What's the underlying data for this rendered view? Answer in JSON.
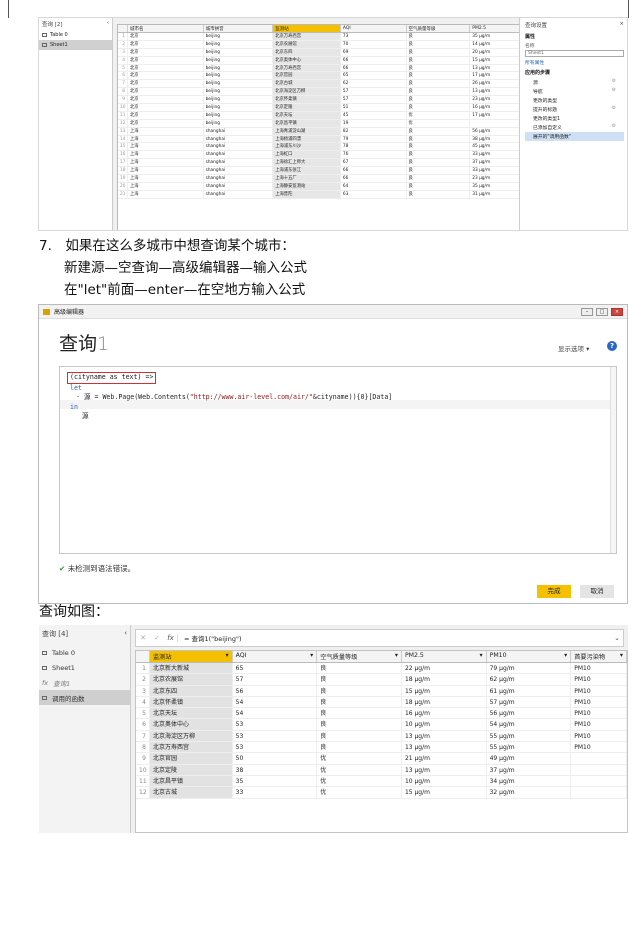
{
  "s1": {
    "left_title": "查询 [2]",
    "left_items": [
      "Table 0",
      "Sheet1"
    ],
    "headers": [
      "城市名",
      "城市拼音",
      "监测站",
      "AQI",
      "空气质量等级",
      "PM2.5"
    ],
    "rows": [
      [
        "1",
        "北京",
        "beijing",
        "北京万寿西宫",
        "73",
        "良",
        "35 μg/m"
      ],
      [
        "2",
        "北京",
        "beijing",
        "北京农展馆",
        "70",
        "良",
        "14 μg/m"
      ],
      [
        "3",
        "北京",
        "beijing",
        "北京东四",
        "69",
        "良",
        "20 μg/m"
      ],
      [
        "4",
        "北京",
        "beijing",
        "北京奥体中心",
        "66",
        "良",
        "15 μg/m"
      ],
      [
        "5",
        "北京",
        "beijing",
        "北京万寿西宫",
        "66",
        "良",
        "13 μg/m"
      ],
      [
        "6",
        "北京",
        "beijing",
        "北京官园",
        "65",
        "良",
        "17 μg/m"
      ],
      [
        "7",
        "北京",
        "beijing",
        "北京古城",
        "62",
        "良",
        "26 μg/m"
      ],
      [
        "8",
        "北京",
        "beijing",
        "北京海淀区万柳",
        "57",
        "良",
        "13 μg/m"
      ],
      [
        "9",
        "北京",
        "beijing",
        "北京怀柔镇",
        "57",
        "良",
        "23 μg/m"
      ],
      [
        "10",
        "北京",
        "beijing",
        "北京定陵",
        "51",
        "良",
        "16 μg/m"
      ],
      [
        "11",
        "北京",
        "beijing",
        "北京天坛",
        "45",
        "优",
        "17 μg/m"
      ],
      [
        "12",
        "北京",
        "beijing",
        "北京昌平镇",
        "19",
        "优",
        ""
      ],
      [
        "13",
        "上海",
        "shanghai",
        "上海青浦淀山湖",
        "82",
        "良",
        "56 μg/m"
      ],
      [
        "14",
        "上海",
        "shanghai",
        "上海杨浦四漂",
        "79",
        "良",
        "38 μg/m"
      ],
      [
        "15",
        "上海",
        "shanghai",
        "上海浦东川沙",
        "78",
        "良",
        "45 μg/m"
      ],
      [
        "16",
        "上海",
        "shanghai",
        "上海虹口",
        "76",
        "良",
        "33 μg/m"
      ],
      [
        "17",
        "上海",
        "shanghai",
        "上海徐汇上师大",
        "67",
        "良",
        "37 μg/m"
      ],
      [
        "18",
        "上海",
        "shanghai",
        "上海浦东张江",
        "66",
        "良",
        "33 μg/m"
      ],
      [
        "19",
        "上海",
        "shanghai",
        "上海十五厂",
        "66",
        "良",
        "23 μg/m"
      ],
      [
        "20",
        "上海",
        "shanghai",
        "上海静安监测站",
        "64",
        "良",
        "35 μg/m"
      ],
      [
        "21",
        "上海",
        "shanghai",
        "上海普陀",
        "63",
        "良",
        "31 μg/m"
      ]
    ],
    "right_title": "查询设置",
    "props_label": "属性",
    "name_label": "名称",
    "name_value": "Sheet1",
    "all_props": "所有属性",
    "steps_label": "应用的步骤",
    "steps": [
      "源",
      "导航",
      "更改的类型",
      "提升的标题",
      "更改的类型1",
      "已添加自定义",
      "展开的\"调用函数\""
    ]
  },
  "text1": "7.　如果在这么多城市中想查询某个城市：",
  "text2": "新建源—空查询—高级编辑器—输入公式",
  "text3": "在\"let\"前面—enter—在空地方输入公式",
  "editor": {
    "window_title": "高级编辑器",
    "query_name": "查询",
    "query_num": "1",
    "display_options": "显示选项",
    "code_param": "(cityname as text) =>",
    "code_let": "let",
    "code_src_pre": "源 = Web.Page(Web.Contents(",
    "code_src_str": "\"http://www.air-level.com/air/\"",
    "code_src_post": "&cityname)){0}[Data]",
    "code_in": "in",
    "code_src": "源",
    "status": "未检测到语法错误。",
    "done": "完成",
    "cancel": "取消"
  },
  "text4": "查询如图：",
  "s3": {
    "left_title": "查询 [4]",
    "left_items": [
      "Table 0",
      "Sheet1",
      "查询1",
      "调用的函数"
    ],
    "formula": "= 查询1(\"beijing\")",
    "headers": [
      "监测站",
      "AQI",
      "空气质量等级",
      "PM2.5",
      "PM10",
      "首要污染物"
    ],
    "rows": [
      [
        "1",
        "北京新大新城",
        "65",
        "良",
        "22 μg/m",
        "79 μg/m",
        "PM10"
      ],
      [
        "2",
        "北京农展馆",
        "57",
        "良",
        "18 μg/m",
        "62 μg/m",
        "PM10"
      ],
      [
        "3",
        "北京东四",
        "56",
        "良",
        "15 μg/m",
        "61 μg/m",
        "PM10"
      ],
      [
        "4",
        "北京怀柔镇",
        "54",
        "良",
        "18 μg/m",
        "57 μg/m",
        "PM10"
      ],
      [
        "5",
        "北京天坛",
        "54",
        "良",
        "16 μg/m",
        "56 μg/m",
        "PM10"
      ],
      [
        "6",
        "北京奥体中心",
        "53",
        "良",
        "10 μg/m",
        "54 μg/m",
        "PM10"
      ],
      [
        "7",
        "北京海淀区万柳",
        "53",
        "良",
        "13 μg/m",
        "55 μg/m",
        "PM10"
      ],
      [
        "8",
        "北京万寿西宫",
        "53",
        "良",
        "13 μg/m",
        "55 μg/m",
        "PM10"
      ],
      [
        "9",
        "北京官园",
        "50",
        "优",
        "21 μg/m",
        "49 μg/m",
        ""
      ],
      [
        "10",
        "北京定陵",
        "38",
        "优",
        "13 μg/m",
        "37 μg/m",
        ""
      ],
      [
        "11",
        "北京昌平镇",
        "35",
        "优",
        "10 μg/m",
        "34 μg/m",
        ""
      ],
      [
        "12",
        "北京古城",
        "33",
        "优",
        "15 μg/m",
        "32 μg/m",
        ""
      ]
    ]
  }
}
